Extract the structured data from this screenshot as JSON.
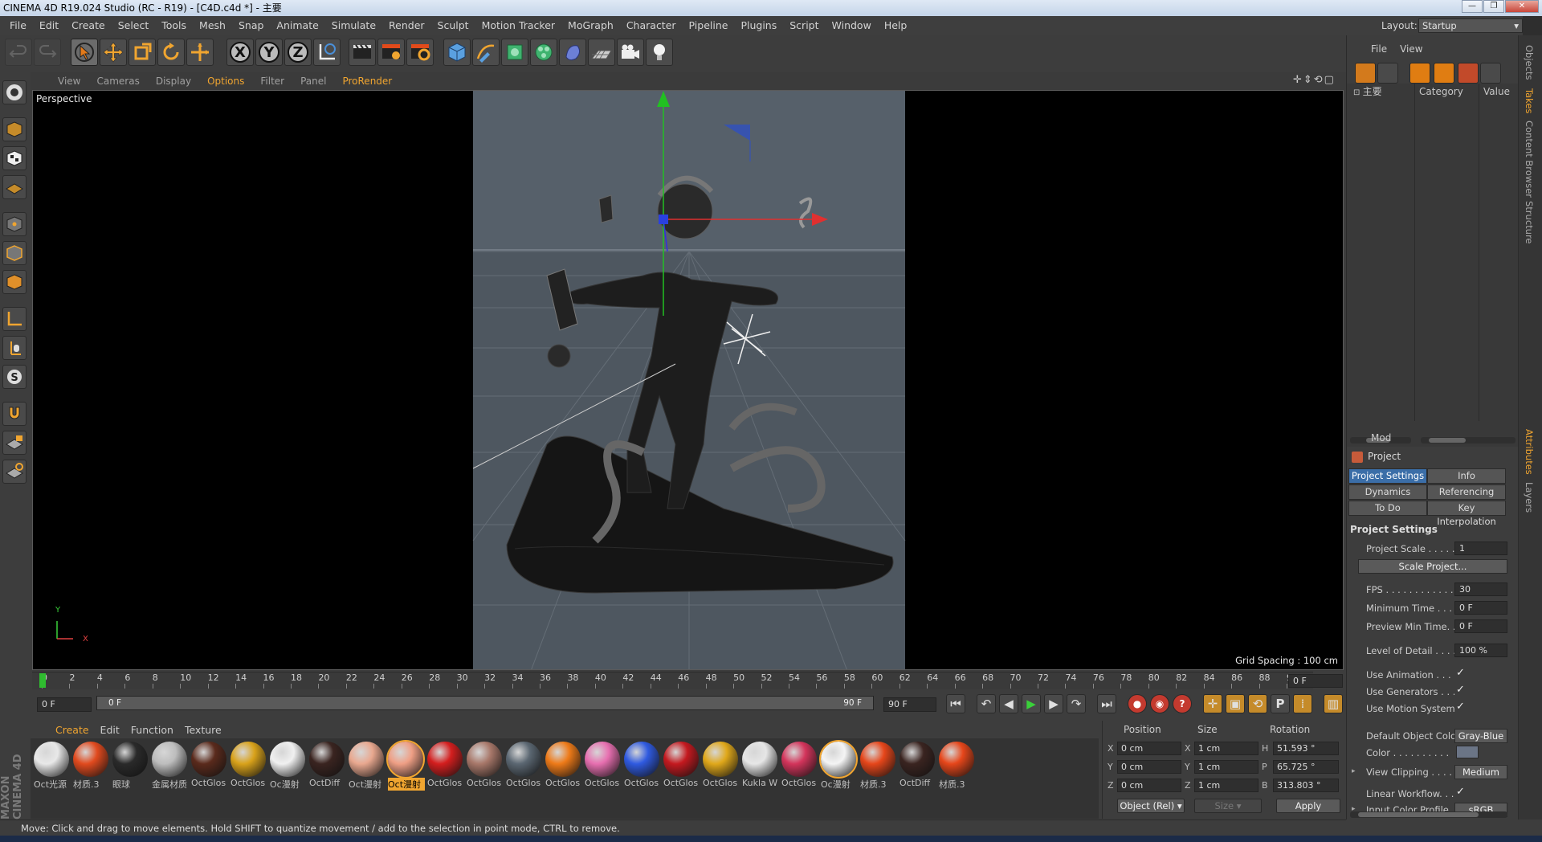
{
  "window": {
    "title": "CINEMA 4D R19.024 Studio (RC - R19) - [C4D.c4d *] - 主要",
    "buttons": [
      "—",
      "❐",
      "✕"
    ]
  },
  "menu": {
    "items": [
      "File",
      "Edit",
      "Create",
      "Select",
      "Tools",
      "Mesh",
      "Snap",
      "Animate",
      "Simulate",
      "Render",
      "Sculpt",
      "Motion Tracker",
      "MoGraph",
      "Character",
      "Pipeline",
      "Plugins",
      "Script",
      "Window",
      "Help"
    ],
    "layout_label": "Layout:",
    "layout_value": "Startup"
  },
  "toolbar": {
    "axis_x": "X",
    "axis_y": "Y",
    "axis_z": "Z"
  },
  "viewport": {
    "menu": [
      "View",
      "Cameras",
      "Display",
      "Options",
      "Filter",
      "Panel",
      "ProRender"
    ],
    "highlight_items": [
      "Options",
      "ProRender"
    ],
    "nav_icons": "✛⇕⟲▢",
    "camera_label": "Perspective",
    "grid_spacing": "Grid Spacing : 100 cm",
    "axis_y_label": "Y",
    "axis_x_label": "X"
  },
  "timeline": {
    "ticks": [
      "0",
      "2",
      "4",
      "6",
      "8",
      "10",
      "12",
      "14",
      "16",
      "18",
      "20",
      "22",
      "24",
      "26",
      "28",
      "30",
      "32",
      "34",
      "36",
      "38",
      "40",
      "42",
      "44",
      "46",
      "48",
      "50",
      "52",
      "54",
      "56",
      "58",
      "60",
      "62",
      "64",
      "66",
      "68",
      "70",
      "72",
      "74",
      "76",
      "78",
      "80",
      "82",
      "84",
      "86",
      "88",
      "90"
    ],
    "current_frame_field": "0 F",
    "start_field": "0 F",
    "range_start": "0 F",
    "range_end": "90 F",
    "end_field": "90 F"
  },
  "materials": {
    "menu": [
      "Create",
      "Edit",
      "Function",
      "Texture"
    ],
    "items": [
      {
        "label": "Oct光源",
        "color": "#e8e8e8"
      },
      {
        "label": "材质.3",
        "color": "#e14a1e"
      },
      {
        "label": "眼球",
        "color": "#2a2a2a"
      },
      {
        "label": "金属材质",
        "color": "#bdbdbd"
      },
      {
        "label": "OctGlos",
        "color": "#5a2a1c"
      },
      {
        "label": "OctGlos",
        "color": "#d9a21a"
      },
      {
        "label": "Oc漫射",
        "color": "#f0f0f0"
      },
      {
        "label": "OctDiff",
        "color": "#3a2420"
      },
      {
        "label": "Oct漫射",
        "color": "#e9a88f"
      },
      {
        "label": "Oct漫射",
        "color": "#ef9f85",
        "selected": true
      },
      {
        "label": "OctGlos",
        "color": "#d41e1e"
      },
      {
        "label": "OctGlos",
        "color": "#a8786a"
      },
      {
        "label": "OctGlos",
        "color": "#5b6772"
      },
      {
        "label": "OctGlos",
        "color": "#ee7a18"
      },
      {
        "label": "OctGlos",
        "color": "#e76fb0"
      },
      {
        "label": "OctGlos",
        "color": "#2f5ae0"
      },
      {
        "label": "OctGlos",
        "color": "#c4191f"
      },
      {
        "label": "OctGlos",
        "color": "#e0a81a"
      },
      {
        "label": "Kukla W",
        "color": "#e6e6e6"
      },
      {
        "label": "OctGlos",
        "color": "#d3345b"
      },
      {
        "label": "Oc漫射",
        "color": "#f4f4f4",
        "outlined": true
      },
      {
        "label": "材质.3",
        "color": "#e6461a"
      },
      {
        "label": "OctDiff",
        "color": "#3a2420"
      },
      {
        "label": "材质.3",
        "color": "#e6461a"
      }
    ]
  },
  "coords": {
    "headers": [
      "Position",
      "Size",
      "Rotation"
    ],
    "rows": [
      {
        "axis": "X",
        "pos": "0 cm",
        "size_axis": "X",
        "size": "1 cm",
        "rot_axis": "H",
        "rot": "51.593 °"
      },
      {
        "axis": "Y",
        "pos": "0 cm",
        "size_axis": "Y",
        "size": "1 cm",
        "rot_axis": "P",
        "rot": "65.725 °"
      },
      {
        "axis": "Z",
        "pos": "0 cm",
        "size_axis": "Z",
        "size": "1 cm",
        "rot_axis": "B",
        "rot": "313.803 °"
      }
    ],
    "mode": "Object (Rel)",
    "size_mode": "Size",
    "apply": "Apply"
  },
  "status": "Move: Click and drag to move elements. Hold SHIFT to quantize movement / add to the selection in point mode, CTRL to remove.",
  "objects_panel": {
    "menu": [
      "File",
      "View"
    ],
    "col_name": "主要",
    "col_category": "Category",
    "col_value": "Value"
  },
  "attributes": {
    "mode": "Mod",
    "object": "Project",
    "tabs": [
      "Project Settings",
      "Info",
      "Dynamics",
      "Referencing",
      "To Do",
      "Key Interpolation"
    ],
    "section": "Project Settings",
    "fields": {
      "scale_label": "Project Scale . . . . . .",
      "scale_value": "1",
      "scale_button": "Scale Project...",
      "fps_label": "FPS . . . . . . . . . . . . . .",
      "fps_value": "30",
      "min_time_label": "Minimum Time . . . . .",
      "min_time_value": "0 F",
      "preview_min_label": "Preview Min Time. . .",
      "preview_min_value": "0 F",
      "lod_label": "Level of Detail . . . . .",
      "lod_value": "100 %",
      "use_anim_label": "Use Animation . . . . .",
      "use_gen_label": "Use Generators . . . .",
      "use_motion_label": "Use Motion System",
      "check": "✓",
      "default_color_label": "Default Object Color",
      "default_color_value": "Gray-Blue",
      "color_label": "Color . . . . . . . . . .",
      "view_clip_label": "View Clipping . . . . .",
      "view_clip_value": "Medium",
      "linear_wf_label": "Linear Workflow. . . .",
      "input_profile_label": "Input Color Profile . .",
      "input_profile_value": "sRGB"
    }
  },
  "side_tabs": [
    "Objects",
    "Takes",
    "Content Browser",
    "Structure",
    "Attributes",
    "Layers"
  ]
}
